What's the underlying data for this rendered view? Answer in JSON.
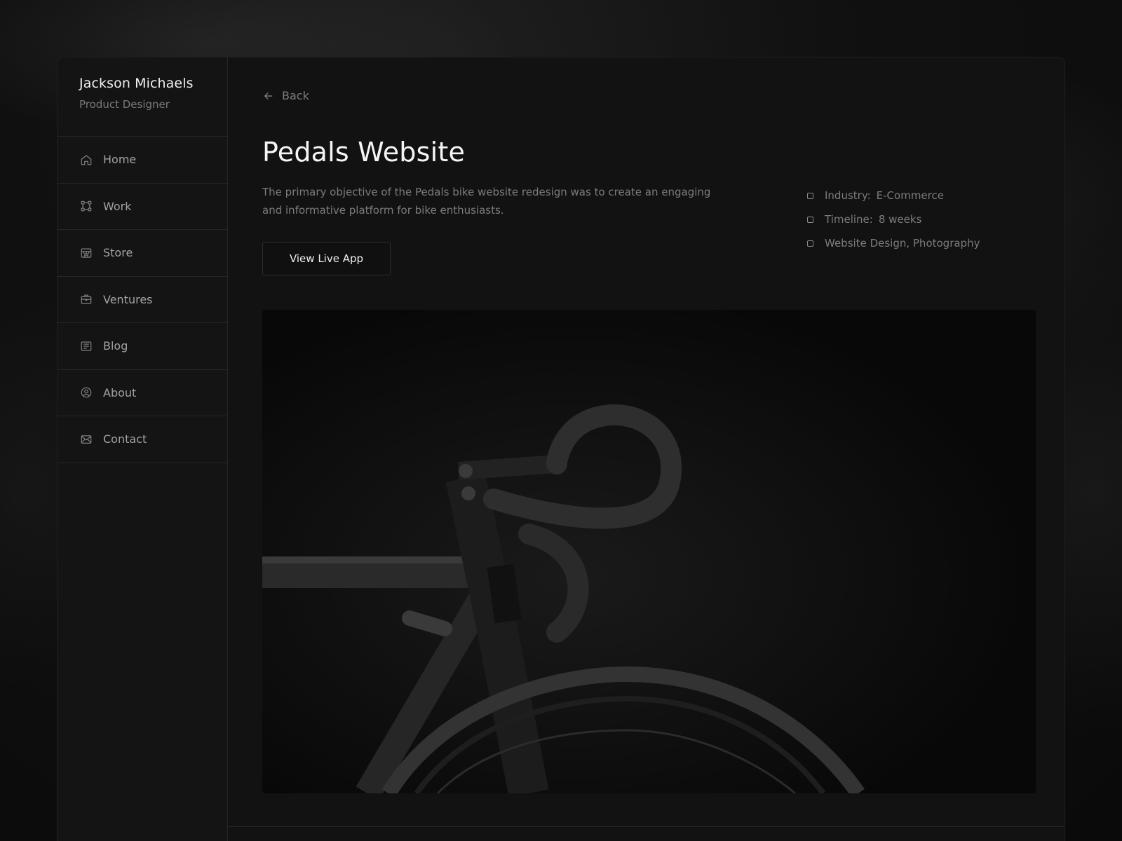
{
  "profile": {
    "name": "Jackson Michaels",
    "role": "Product Designer"
  },
  "sidebar": {
    "items": [
      {
        "label": "Home",
        "icon": "home-icon"
      },
      {
        "label": "Work",
        "icon": "work-icon"
      },
      {
        "label": "Store",
        "icon": "store-icon"
      },
      {
        "label": "Ventures",
        "icon": "briefcase-icon"
      },
      {
        "label": "Blog",
        "icon": "blog-icon"
      },
      {
        "label": "About",
        "icon": "user-circle-icon"
      },
      {
        "label": "Contact",
        "icon": "mail-icon"
      }
    ]
  },
  "main": {
    "back_label": "Back",
    "title": "Pedals Website",
    "description": "The primary objective of the Pedals bike website redesign was to create an engaging and informative platform for bike enthusiasts.",
    "cta_label": "View Live App",
    "meta": [
      {
        "key": "Industry:",
        "value": "E-Commerce"
      },
      {
        "key": "Timeline:",
        "value": "8 weeks"
      },
      {
        "key": "",
        "value": "Website Design, Photography"
      }
    ]
  },
  "colors": {
    "background": "#121212",
    "border": "#262626",
    "text_primary": "#f5f5f5",
    "text_muted": "#7c7c7c"
  }
}
